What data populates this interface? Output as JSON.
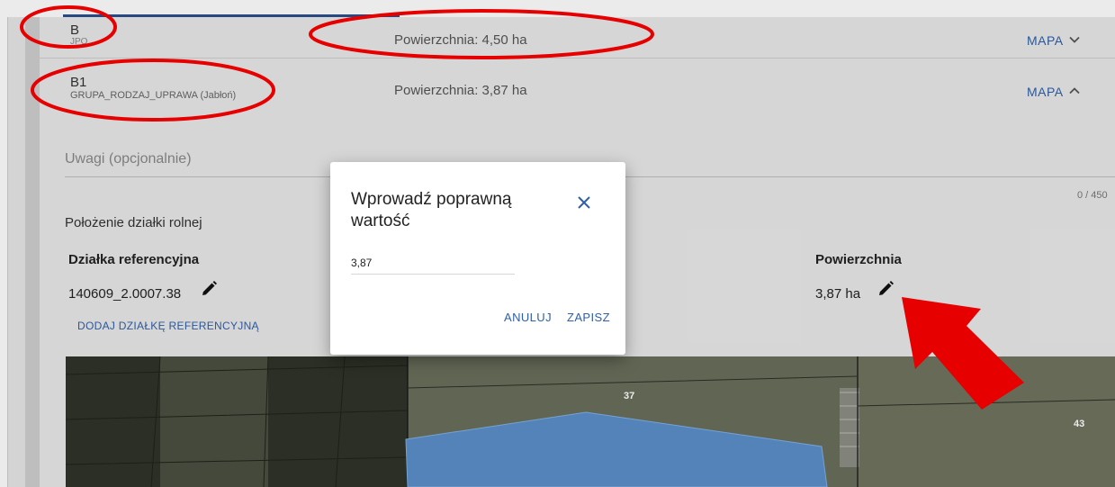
{
  "rows": [
    {
      "code": "B",
      "sub": "JPO",
      "area": "Powierzchnia: 4,50 ha",
      "map_label": "MAPA",
      "chevron": "chevron-down-icon"
    },
    {
      "code": "B1",
      "sub": "GRUPA_RODZAJ_UPRAWA (Jabłoń)",
      "area": "Powierzchnia: 3,87 ha",
      "map_label": "MAPA",
      "chevron": "chevron-up-icon"
    }
  ],
  "notes": {
    "placeholder": "Uwagi (opcjonalnie)",
    "counter": "0 / 450"
  },
  "location": {
    "title": "Położenie działki rolnej",
    "col_parcel": "Działka referencyjna",
    "col_area": "Powierzchnia",
    "parcel_id": "140609_2.0007.38",
    "area_value": "3,87 ha",
    "add_parcel": "DODAJ DZIAŁKĘ REFERENCYJNĄ"
  },
  "map": {
    "labels": [
      "37",
      "43"
    ],
    "parcel_color": "#5b8fc9"
  },
  "dialog": {
    "title": "Wprowadź poprawną wartość",
    "value": "3,87",
    "cancel": "ANULUJ",
    "save": "ZAPISZ"
  },
  "colors": {
    "accent": "#2f5fa8",
    "annotation": "#e60000"
  }
}
